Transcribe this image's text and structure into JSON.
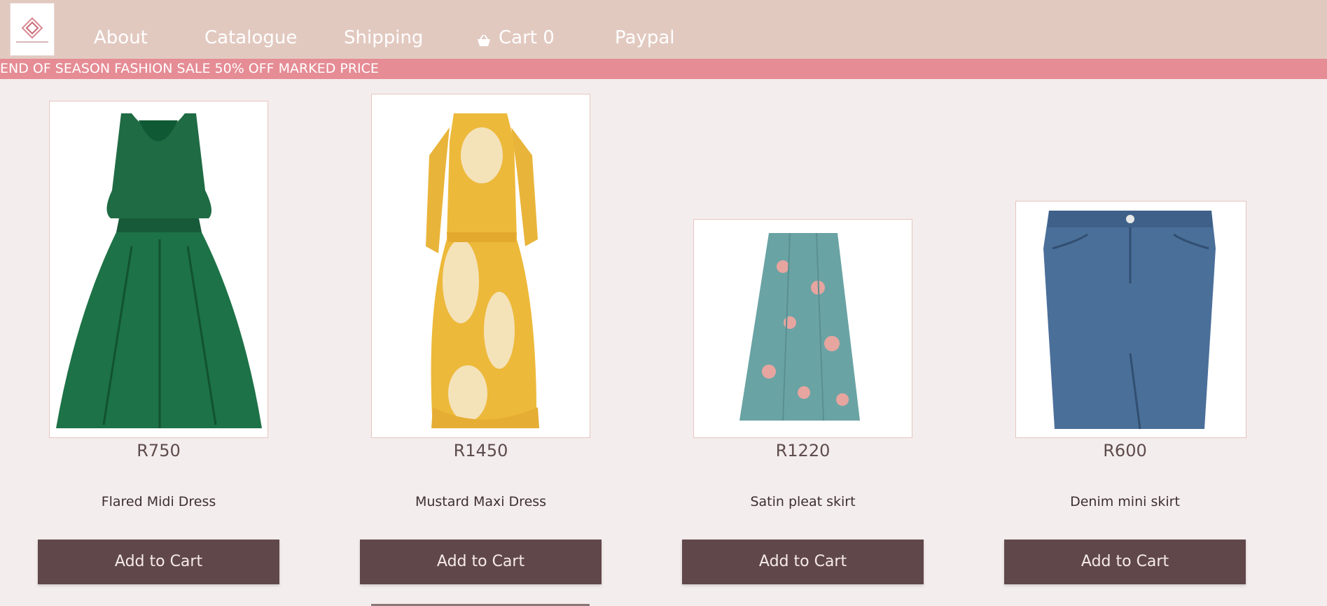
{
  "nav": {
    "about": "About",
    "catalogue": "Catalogue",
    "shipping": "Shipping",
    "cart": "Cart 0",
    "paypal": "Paypal"
  },
  "banner": {
    "text": "END OF SEASON FASHION SALE 50% OFF MARKED PRICE"
  },
  "products": [
    {
      "price": "R750",
      "name": "Flared Midi Dress",
      "button": "Add to Cart",
      "image": "green-sleeveless-midi-dress"
    },
    {
      "price": "R1450",
      "name": "Mustard Maxi Dress",
      "button": "Add to Cart",
      "image": "mustard-floral-maxi-dress"
    },
    {
      "price": "R1220",
      "name": "Satin pleat skirt",
      "button": "Add to Cart",
      "image": "teal-floral-pleat-skirt"
    },
    {
      "price": "R600",
      "name": "Denim mini skirt",
      "button": "Add to Cart",
      "image": "blue-denim-skirt"
    }
  ],
  "colors": {
    "navbar": "#e2c9c0",
    "banner": "#e58c95",
    "button": "#60474a",
    "page": "#f4eded"
  }
}
